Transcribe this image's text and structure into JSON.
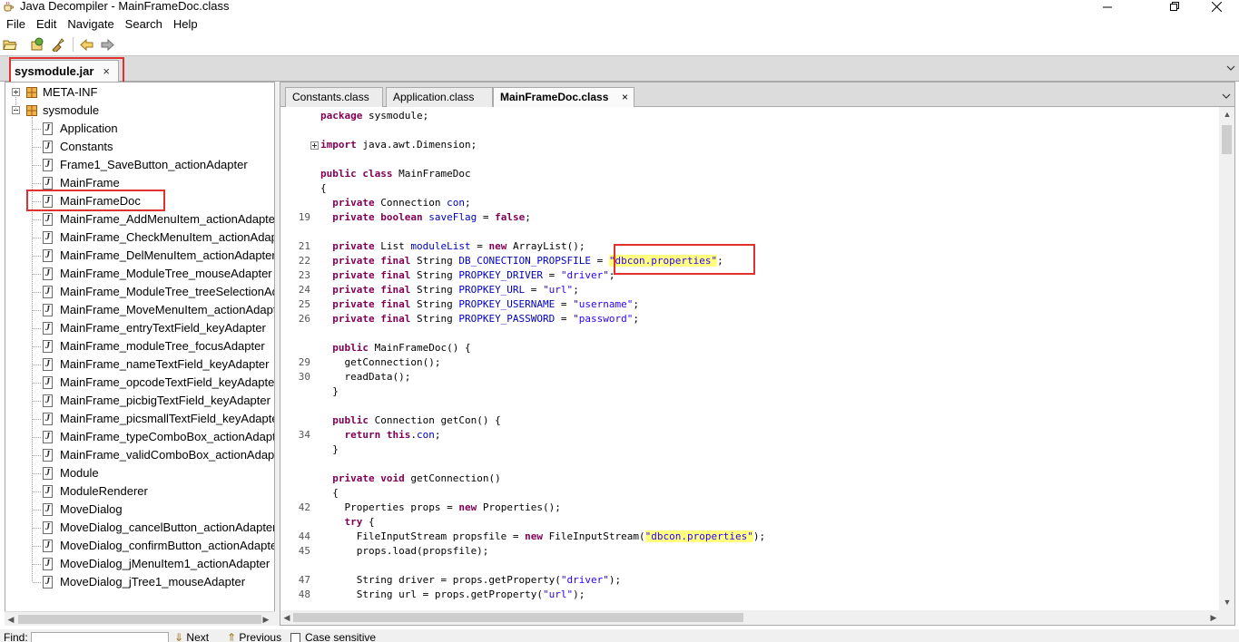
{
  "window": {
    "title": "Java Decompiler - MainFrameDoc.class"
  },
  "menu": [
    "File",
    "Edit",
    "Navigate",
    "Search",
    "Help"
  ],
  "file_tab": {
    "label": "sysmodule.jar",
    "close": "×"
  },
  "tree": {
    "packages": [
      {
        "name": "META-INF",
        "expanded": false
      },
      {
        "name": "sysmodule",
        "expanded": true
      }
    ],
    "classes": [
      "Application",
      "Constants",
      "Frame1_SaveButton_actionAdapter",
      "MainFrame",
      "MainFrameDoc",
      "MainFrame_AddMenuItem_actionAdapter",
      "MainFrame_CheckMenuItem_actionAdapter",
      "MainFrame_DelMenuItem_actionAdapter",
      "MainFrame_ModuleTree_mouseAdapter",
      "MainFrame_ModuleTree_treeSelectionAdapter",
      "MainFrame_MoveMenuItem_actionAdapter",
      "MainFrame_entryTextField_keyAdapter",
      "MainFrame_moduleTree_focusAdapter",
      "MainFrame_nameTextField_keyAdapter",
      "MainFrame_opcodeTextField_keyAdapter",
      "MainFrame_picbigTextField_keyAdapter",
      "MainFrame_picsmallTextField_keyAdapter",
      "MainFrame_typeComboBox_actionAdapter",
      "MainFrame_validComboBox_actionAdapter",
      "Module",
      "ModuleRenderer",
      "MoveDialog",
      "MoveDialog_cancelButton_actionAdapter",
      "MoveDialog_confirmButton_actionAdapter",
      "MoveDialog_jMenuItem1_actionAdapter",
      "MoveDialog_jTree1_mouseAdapter"
    ],
    "class_icon_glyph": "J"
  },
  "editor_tabs": [
    {
      "label": "Constants.class",
      "active": false
    },
    {
      "label": "Application.class",
      "active": false
    },
    {
      "label": "MainFrameDoc.class",
      "active": true
    }
  ],
  "editor_tab_close": "×",
  "code": [
    {
      "n": "",
      "t": [
        [
          "kw",
          "package"
        ],
        [
          "",
          " sysmodule;"
        ]
      ]
    },
    {
      "n": "",
      "t": []
    },
    {
      "n": "",
      "fold": true,
      "t": [
        [
          "kw",
          "import"
        ],
        [
          "",
          " java.awt.Dimension;"
        ]
      ]
    },
    {
      "n": "",
      "t": []
    },
    {
      "n": "",
      "t": [
        [
          "kw",
          "public class"
        ],
        [
          "",
          " MainFrameDoc"
        ]
      ]
    },
    {
      "n": "",
      "t": [
        [
          "",
          "{"
        ]
      ]
    },
    {
      "n": "",
      "t": [
        [
          "",
          "  "
        ],
        [
          "kw",
          "private"
        ],
        [
          "",
          " Connection "
        ],
        [
          "fld",
          "con"
        ],
        [
          "",
          ";"
        ]
      ]
    },
    {
      "n": "19",
      "t": [
        [
          "",
          "  "
        ],
        [
          "kw",
          "private boolean"
        ],
        [
          "",
          " "
        ],
        [
          "fld",
          "saveFlag"
        ],
        [
          "",
          " = "
        ],
        [
          "kw",
          "false"
        ],
        [
          "",
          ";"
        ]
      ]
    },
    {
      "n": "",
      "t": []
    },
    {
      "n": "21",
      "t": [
        [
          "",
          "  "
        ],
        [
          "kw",
          "private"
        ],
        [
          "",
          " List "
        ],
        [
          "fld",
          "moduleList"
        ],
        [
          "",
          " = "
        ],
        [
          "kw",
          "new"
        ],
        [
          "",
          " ArrayList();"
        ]
      ]
    },
    {
      "n": "22",
      "t": [
        [
          "",
          "  "
        ],
        [
          "kw",
          "private final"
        ],
        [
          "",
          " String "
        ],
        [
          "fld",
          "DB_CONECTION_PROPSFILE"
        ],
        [
          "",
          " = "
        ],
        [
          "str hl",
          "\"dbcon.properties\""
        ],
        [
          "",
          ";"
        ]
      ]
    },
    {
      "n": "23",
      "t": [
        [
          "",
          "  "
        ],
        [
          "kw",
          "private final"
        ],
        [
          "",
          " String "
        ],
        [
          "fld",
          "PROPKEY_DRIVER"
        ],
        [
          "",
          " = "
        ],
        [
          "str",
          "\"driver\""
        ],
        [
          "",
          ";"
        ]
      ]
    },
    {
      "n": "24",
      "t": [
        [
          "",
          "  "
        ],
        [
          "kw",
          "private final"
        ],
        [
          "",
          " String "
        ],
        [
          "fld",
          "PROPKEY_URL"
        ],
        [
          "",
          " = "
        ],
        [
          "str",
          "\"url\""
        ],
        [
          "",
          ";"
        ]
      ]
    },
    {
      "n": "25",
      "t": [
        [
          "",
          "  "
        ],
        [
          "kw",
          "private final"
        ],
        [
          "",
          " String "
        ],
        [
          "fld",
          "PROPKEY_USERNAME"
        ],
        [
          "",
          " = "
        ],
        [
          "str",
          "\"username\""
        ],
        [
          "",
          ";"
        ]
      ]
    },
    {
      "n": "26",
      "t": [
        [
          "",
          "  "
        ],
        [
          "kw",
          "private final"
        ],
        [
          "",
          " String "
        ],
        [
          "fld",
          "PROPKEY_PASSWORD"
        ],
        [
          "",
          " = "
        ],
        [
          "str",
          "\"password\""
        ],
        [
          "",
          ";"
        ]
      ]
    },
    {
      "n": "",
      "t": []
    },
    {
      "n": "",
      "t": [
        [
          "",
          "  "
        ],
        [
          "kw",
          "public"
        ],
        [
          "",
          " MainFrameDoc() {"
        ]
      ]
    },
    {
      "n": "29",
      "t": [
        [
          "",
          "    getConnection();"
        ]
      ]
    },
    {
      "n": "30",
      "t": [
        [
          "",
          "    readData();"
        ]
      ]
    },
    {
      "n": "",
      "t": [
        [
          "",
          "  }"
        ]
      ]
    },
    {
      "n": "",
      "t": []
    },
    {
      "n": "",
      "t": [
        [
          "",
          "  "
        ],
        [
          "kw",
          "public"
        ],
        [
          "",
          " Connection getCon() {"
        ]
      ]
    },
    {
      "n": "34",
      "t": [
        [
          "",
          "    "
        ],
        [
          "kw",
          "return this"
        ],
        [
          "",
          "."
        ],
        [
          "fld",
          "con"
        ],
        [
          "",
          ";"
        ]
      ]
    },
    {
      "n": "",
      "t": [
        [
          "",
          "  }"
        ]
      ]
    },
    {
      "n": "",
      "t": []
    },
    {
      "n": "",
      "t": [
        [
          "",
          "  "
        ],
        [
          "kw",
          "private void"
        ],
        [
          "",
          " getConnection()"
        ]
      ]
    },
    {
      "n": "",
      "t": [
        [
          "",
          "  {"
        ]
      ]
    },
    {
      "n": "42",
      "t": [
        [
          "",
          "    Properties props = "
        ],
        [
          "kw",
          "new"
        ],
        [
          "",
          " Properties();"
        ]
      ]
    },
    {
      "n": "",
      "t": [
        [
          "",
          "    "
        ],
        [
          "kw",
          "try"
        ],
        [
          "",
          " {"
        ]
      ]
    },
    {
      "n": "44",
      "t": [
        [
          "",
          "      FileInputStream propsfile = "
        ],
        [
          "kw",
          "new"
        ],
        [
          "",
          " FileInputStream("
        ],
        [
          "str hl",
          "\"dbcon.properties\""
        ],
        [
          "",
          ");"
        ]
      ]
    },
    {
      "n": "45",
      "t": [
        [
          "",
          "      props.load(propsfile);"
        ]
      ]
    },
    {
      "n": "",
      "t": []
    },
    {
      "n": "47",
      "t": [
        [
          "",
          "      String driver = props.getProperty("
        ],
        [
          "str",
          "\"driver\""
        ],
        [
          "",
          ");"
        ]
      ]
    },
    {
      "n": "48",
      "t": [
        [
          "",
          "      String url = props.getProperty("
        ],
        [
          "str",
          "\"url\""
        ],
        [
          "",
          ");"
        ]
      ]
    }
  ],
  "findbar": {
    "label": "Find:",
    "next": "Next",
    "previous": "Previous",
    "case_sensitive": "Case sensitive"
  },
  "colors": {
    "keyword": "#7f0055",
    "field": "#0000c0",
    "string": "#2a00ff",
    "highlight": "#ffff80",
    "annotation_box": "#e03030"
  }
}
